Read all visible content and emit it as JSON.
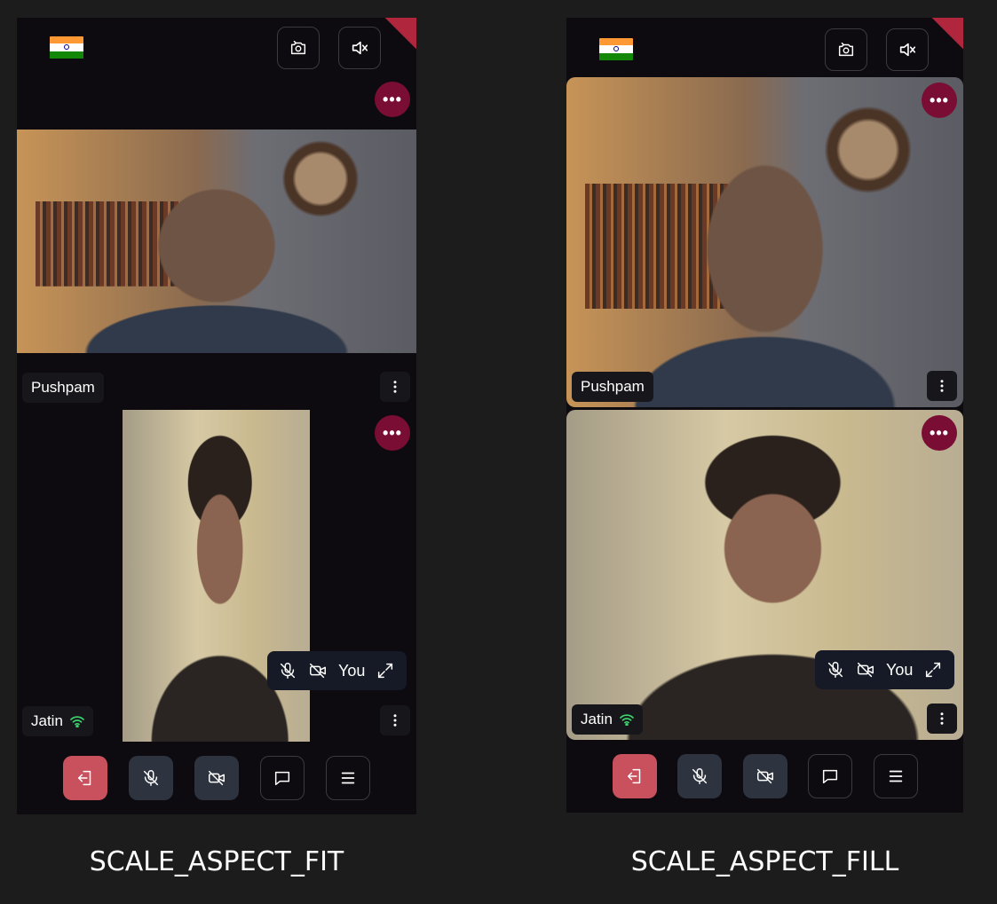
{
  "colors": {
    "background": "#1c1c1c",
    "panel": "#0d0b0f",
    "more_button": "#7a0d33",
    "leave_button": "#c9515e",
    "muted_button": "#2e3340",
    "network_good": "#3ccf6b"
  },
  "icons": {
    "flag": "india-flag-icon",
    "switch_camera": "switch-camera-icon",
    "speaker_off": "speaker-muted-icon",
    "more": "more-horizontal-icon",
    "kebab": "more-vertical-icon",
    "network": "wifi-icon",
    "mic_off": "mic-off-icon",
    "video_off": "video-off-icon",
    "expand": "expand-icon",
    "leave": "leave-icon",
    "chat": "chat-icon",
    "menu": "menu-icon"
  },
  "fit": {
    "caption": "SCALE_ASPECT_FIT",
    "remote_name": "Pushpam",
    "local_name": "Jatin",
    "self_label": "You"
  },
  "fill": {
    "caption": "SCALE_ASPECT_FILL",
    "remote_name": "Pushpam",
    "local_name": "Jatin",
    "self_label": "You"
  }
}
